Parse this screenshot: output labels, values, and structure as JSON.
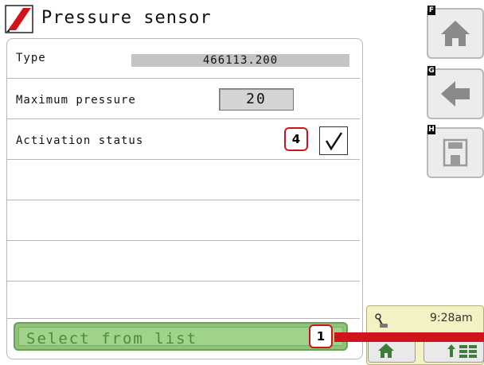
{
  "header": {
    "title": "Pressure sensor",
    "logo_icon": "brand-logo-icon"
  },
  "rows": [
    {
      "label": "Type",
      "value": "466113.200"
    },
    {
      "label": "Maximum pressure",
      "value": "20"
    },
    {
      "label": "Activation status",
      "checked": true
    }
  ],
  "callouts": {
    "activation": "4",
    "select": "1"
  },
  "select_button": {
    "label": "Select from list"
  },
  "softkeys": [
    {
      "tag": "F",
      "icon": "home-icon"
    },
    {
      "tag": "G",
      "icon": "back-arrow-icon"
    },
    {
      "tag": "H",
      "icon": "save-icon"
    }
  ],
  "status": {
    "time": "9:28am",
    "icon": "joystick-icon"
  },
  "bottom_nav": [
    {
      "icon": "home-icon"
    },
    {
      "icon": "menu-grid-icon"
    }
  ],
  "colors": {
    "accent_red": "#d0141b",
    "select_green": "#9fd28a",
    "status_yellow": "#f4f1c4"
  }
}
